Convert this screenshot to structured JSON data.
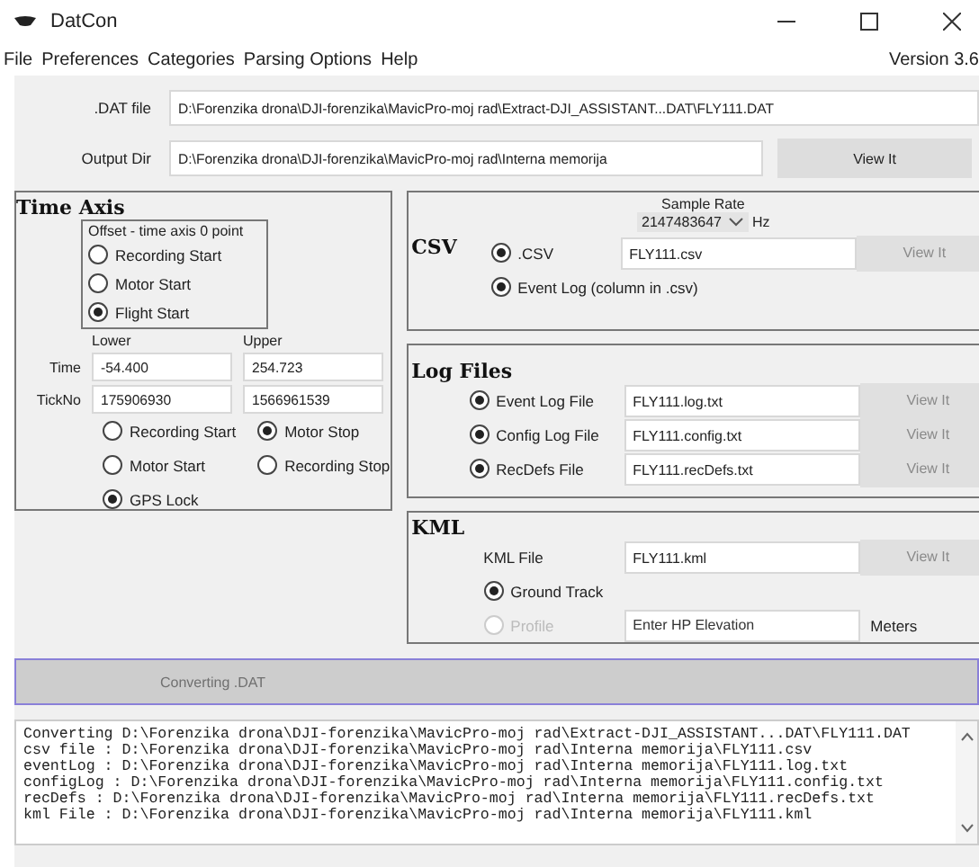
{
  "window": {
    "title": "DatCon"
  },
  "menu": [
    "File",
    "Preferences",
    "Categories",
    "Parsing Options",
    "Help"
  ],
  "version": "Version 3.6",
  "dat_file": {
    "label": ".DAT file",
    "value": "D:\\Forenzika drona\\DJI-forenzika\\MavicPro-moj rad\\Extract-DJI_ASSISTANT...DAT\\FLY111.DAT"
  },
  "output_dir": {
    "label": "Output Dir",
    "value": "D:\\Forenzika drona\\DJI-forenzika\\MavicPro-moj rad\\Interna memorija",
    "button": {
      "label": "View It",
      "disabled": false
    }
  },
  "time_axis": {
    "title": "Time Axis",
    "offset_title": "Offset - time axis 0 point",
    "offset_options": [
      {
        "label": "Recording Start",
        "selected": false
      },
      {
        "label": "Motor Start",
        "selected": false
      },
      {
        "label": "Flight Start",
        "selected": true
      }
    ],
    "lower_label": "Lower",
    "upper_label": "Upper",
    "rows": [
      {
        "label": "Time",
        "lower": "-54.400",
        "upper": "254.723"
      },
      {
        "label": "TickNo",
        "lower": "175906930",
        "upper": "1566961539"
      }
    ],
    "lower_options": [
      {
        "label": "Recording Start",
        "selected": false
      },
      {
        "label": "Motor Start",
        "selected": false
      },
      {
        "label": "GPS Lock",
        "selected": true
      }
    ],
    "upper_options": [
      {
        "label": "Motor Stop",
        "selected": true
      },
      {
        "label": "Recording Stop",
        "selected": false
      }
    ]
  },
  "csv": {
    "title": "CSV",
    "sample_rate_label": "Sample Rate",
    "sample_rate": "2147483647",
    "unit": "Hz",
    "csv_option": {
      "label": ".CSV",
      "selected": true,
      "value": "FLY111.csv",
      "button": {
        "label": "View It",
        "disabled": true
      }
    },
    "event_log_option": {
      "label": "Event Log (column in .csv)",
      "selected": true
    }
  },
  "log_files": {
    "title": "Log Files",
    "items": [
      {
        "label": "Event Log File",
        "selected": true,
        "value": "FLY111.log.txt",
        "button": {
          "label": "View It",
          "disabled": true
        }
      },
      {
        "label": "Config Log File",
        "selected": true,
        "value": "FLY111.config.txt",
        "button": {
          "label": "View It",
          "disabled": true
        }
      },
      {
        "label": "RecDefs File",
        "selected": true,
        "value": "FLY111.recDefs.txt",
        "button": {
          "label": "View It",
          "disabled": true
        }
      }
    ]
  },
  "kml": {
    "title": "KML",
    "file_label": "KML File",
    "value": "FLY111.kml",
    "button": {
      "label": "View It",
      "disabled": true
    },
    "options": [
      {
        "kind": "plain",
        "label": "Ground Track",
        "selected": true,
        "disabled": false
      },
      {
        "kind": "elevation",
        "label": "Profile",
        "selected": false,
        "disabled": true,
        "placeholder": "Enter HP Elevation",
        "unit": "Meters"
      }
    ]
  },
  "convert_button": {
    "label": "Converting .DAT",
    "disabled": true
  },
  "log": [
    "Converting D:\\Forenzika drona\\DJI-forenzika\\MavicPro-moj rad\\Extract-DJI_ASSISTANT...DAT\\FLY111.DAT",
    "csv file : D:\\Forenzika drona\\DJI-forenzika\\MavicPro-moj rad\\Interna memorija\\FLY111.csv",
    "eventLog : D:\\Forenzika drona\\DJI-forenzika\\MavicPro-moj rad\\Interna memorija\\FLY111.log.txt",
    "configLog : D:\\Forenzika drona\\DJI-forenzika\\MavicPro-moj rad\\Interna memorija\\FLY111.config.txt",
    "recDefs : D:\\Forenzika drona\\DJI-forenzika\\MavicPro-moj rad\\Interna memorija\\FLY111.recDefs.txt",
    "kml File : D:\\Forenzika drona\\DJI-forenzika\\MavicPro-moj rad\\Interna memorija\\FLY111.kml"
  ]
}
